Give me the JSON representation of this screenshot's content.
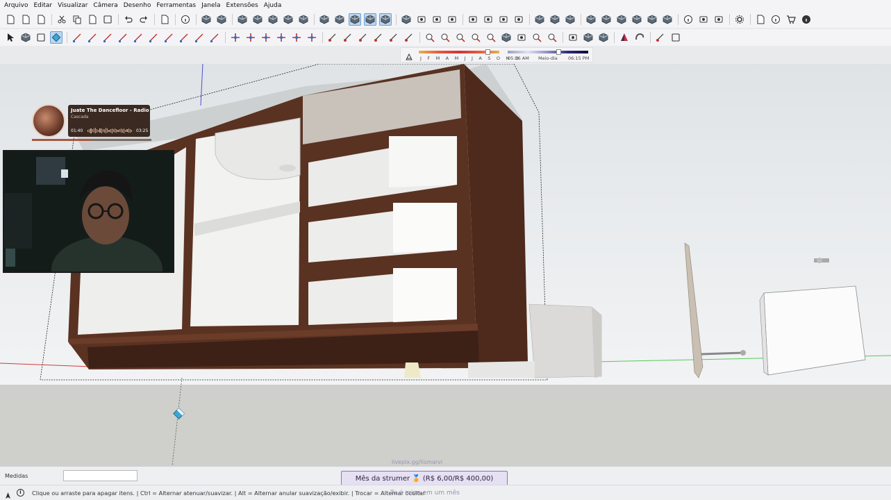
{
  "menu": [
    "Arquivo",
    "Editar",
    "Visualizar",
    "Câmera",
    "Desenho",
    "Ferramentas",
    "Janela",
    "Extensões",
    "Ajuda"
  ],
  "toolbar1": [
    "new-file-icon",
    "open-file-icon",
    "save-icon",
    "|",
    "cut-icon",
    "copy-icon",
    "paste-icon",
    "erase-icon",
    "|",
    "undo-icon",
    "redo-icon",
    "|",
    "print-icon",
    "|",
    "model-info-icon",
    "|",
    "iso-view-icon",
    "top-view-icon",
    "|",
    "front-view-icon",
    "right-view-icon",
    "back-view-icon",
    "left-view-icon",
    "bottom-view-icon",
    "|",
    "xray-icon",
    "wireframe-icon",
    "hidden-line-icon",
    "shaded-icon",
    "shaded-texture-icon",
    "|",
    "component-icon",
    "section-icon",
    "display-section-icon",
    "section-fill-icon",
    "|",
    "camera-icon",
    "warehouse-icon",
    "extension-warehouse-icon",
    "send-icon",
    "|",
    "sandbox-icon",
    "sandbox-smoove-icon",
    "sandbox-stamp-icon",
    "|",
    "solid-outer-shell-icon",
    "solid-intersect-icon",
    "solid-union-icon",
    "solid-subtract-icon",
    "solid-trim-icon",
    "solid-split-icon",
    "|",
    "location-icon",
    "toggle-terrain-icon",
    "cloud-icon",
    "|",
    "settings-icon",
    "|",
    "layout-icon",
    "info-icon",
    "cart-icon",
    "user-icon"
  ],
  "toolbar1_selected": [
    "hidden-line-icon",
    "shaded-icon",
    "shaded-texture-icon"
  ],
  "toolbar2": [
    "select-icon",
    "make-component-icon",
    "paint-bucket-icon",
    "eraser-icon",
    "|",
    "line-icon",
    "freehand-icon",
    "rectangle-icon",
    "rotated-rectangle-icon",
    "circle-icon",
    "polygon-icon",
    "arc-icon",
    "two-point-arc-icon",
    "three-point-arc-icon",
    "pie-icon",
    "|",
    "move-icon",
    "push-pull-icon",
    "rotate-icon",
    "follow-me-icon",
    "scale-icon",
    "offset-icon",
    "|",
    "tape-measure-icon",
    "dimension-icon",
    "protractor-icon",
    "text-icon",
    "axes-icon",
    "3d-text-icon",
    "|",
    "orbit-icon",
    "pan-icon",
    "zoom-icon",
    "zoom-window-icon",
    "zoom-extents-icon",
    "previous-view-icon",
    "position-camera-icon",
    "look-around-icon",
    "walk-icon",
    "|",
    "section-plane-icon",
    "box-icon",
    "solid-box-icon",
    "|",
    "mirror-icon",
    "swirl-icon",
    "|",
    "dimension-tool-icon",
    "more-icon"
  ],
  "toolbar2_selected": [
    "eraser-icon"
  ],
  "shadow": {
    "months": "J F M A M J J A S O N D",
    "time_start": "05:36 AM",
    "time_mid": "Meio-dia",
    "time_end": "06:15 PM"
  },
  "music": {
    "title": "Juate The Dancefloor - Radio",
    "artist": "Cascada",
    "elapsed": "01:40",
    "duration": "03:25",
    "progress": 0.49
  },
  "measure": {
    "label": "Medidas",
    "value": ""
  },
  "status": {
    "text": "Clique ou arraste para apagar itens. | Ctrl = Alternar atenuar/suavizar. | Alt = Alternar anular suavização/exibir. | Trocar = Alternar ocultar"
  },
  "overlay": {
    "goal": "Mês da strumer 🏅 (R$ 6,00/R$ 400,00)",
    "top_text": "livepix.gg/lismarvi",
    "bottom_text": "Tu é mina em um mês"
  },
  "colors": {
    "wood": "#5a3222",
    "wood_dark": "#3d2016",
    "white": "#f4f4f2",
    "selection": "#bcd6ef",
    "goal_border": "#8a76b8"
  }
}
